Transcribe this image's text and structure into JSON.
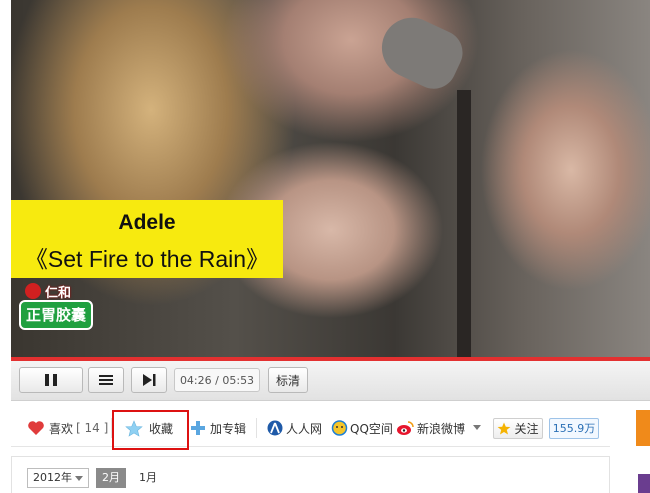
{
  "video": {
    "caption_artist": "Adele",
    "caption_song": "《Set Fire to the Rain》",
    "sponsor_top": "仁和",
    "sponsor_badge": "正胃胶囊"
  },
  "player": {
    "time_current": "04:26",
    "time_separator": "/",
    "time_total": "05:53",
    "quality_label": "标清",
    "progress_color": "#e33030"
  },
  "actions": {
    "like_label": "喜欢",
    "like_count": "[ 14 ]",
    "favorite_label": "收藏",
    "add_album_label": "加专辑",
    "renren_label": "人人网",
    "qzone_label": "QQ空间",
    "weibo_label": "新浪微博",
    "follow_label": "关注",
    "follow_count": "155.9万"
  },
  "date_nav": {
    "year": "2012年",
    "month_active": "2月",
    "month_other": "1月"
  },
  "colors": {
    "highlight": "#dd1111",
    "caption_bg": "#f7ea0f"
  }
}
